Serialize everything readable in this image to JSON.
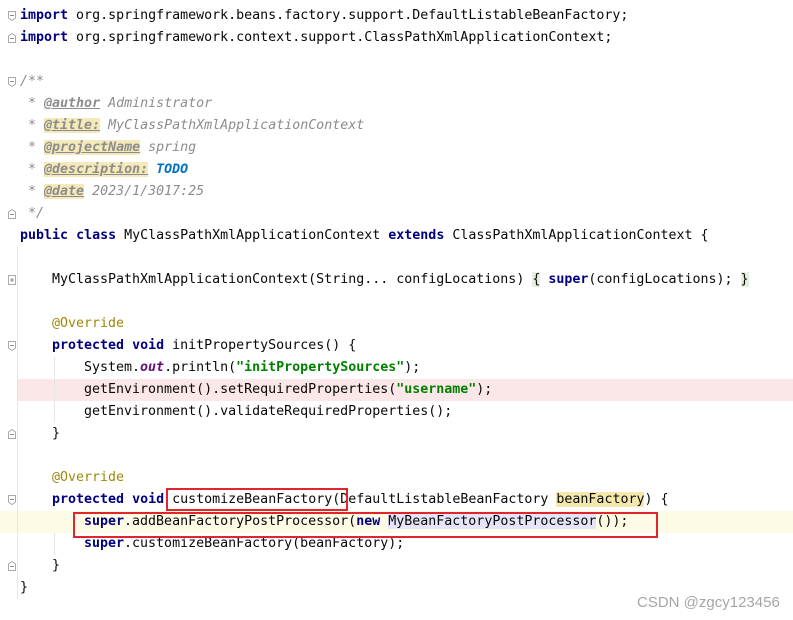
{
  "theme": {
    "keyword": "#000080",
    "string": "#008000",
    "annotation": "#9e880d",
    "comment": "#8c8c8c",
    "doc_tag_warning_bg": "#f3e9b9",
    "todo": "#0073bf",
    "static_field": "#660e7a",
    "error_line_bg": "#fbe7e7",
    "caret_line_bg": "#fdfbe5",
    "usage_bg": "#f5e8ac",
    "identifier_bg": "#e6e4f8",
    "fold_placeholder_bg": "#e4efe0",
    "annotation_box": "#e0262b"
  },
  "icons": {
    "fold_start": "fold-start-icon",
    "fold_end": "fold-end-icon",
    "fold_collapsed": "fold-expand-icon"
  },
  "editor": {
    "lines": {
      "l01": [
        "import",
        " org.springframework.beans.factory.support.DefaultListableBeanFactory;"
      ],
      "l02": [
        "import",
        " org.springframework.context.support.ClassPathXmlApplicationContext;"
      ],
      "l04": [
        "/**"
      ],
      "l05": [
        " * ",
        "@author",
        " Administrator"
      ],
      "l06": [
        " * ",
        "@title:",
        " MyClassPathXmlApplicationContext"
      ],
      "l07": [
        " * ",
        "@projectName",
        " spring"
      ],
      "l08": [
        " * ",
        "@description:",
        " ",
        "TODO"
      ],
      "l09": [
        " * ",
        "@date",
        " 2023/1/3017:25"
      ],
      "l10": [
        " */"
      ],
      "l11": [
        "public",
        " ",
        "class",
        " MyClassPathXmlApplicationContext ",
        "extends",
        " ClassPathXmlApplicationContext {"
      ],
      "l13": [
        "MyClassPathXmlApplicationContext(String... configLocations) ",
        "{",
        " ",
        "super",
        "(configLocations); ",
        "}"
      ],
      "l15": [
        "@Override"
      ],
      "l16": [
        "protected",
        " ",
        "void",
        " initPropertySources() {"
      ],
      "l17": [
        "System.",
        "out",
        ".println(",
        "\"initPropertySources\"",
        ");"
      ],
      "l18": [
        "getEnvironment().setRequiredProperties(",
        "\"username\"",
        ");"
      ],
      "l19": [
        "getEnvironment().validateRequiredProperties();"
      ],
      "l20": [
        "}"
      ],
      "l22": [
        "@Override"
      ],
      "l23": [
        "protected",
        " ",
        "void",
        " ",
        "customizeBeanFactory(",
        "DefaultListableBeanFactory ",
        "beanFactory",
        ") {"
      ],
      "l24": [
        "super",
        ".addBeanFactoryPostProcessor(",
        "new",
        " ",
        "MyBeanFactoryPostProcessor",
        "());"
      ],
      "l25": [
        "super",
        ".customizeBeanFactory(beanFactory);"
      ],
      "l26": [
        "}"
      ],
      "l27": [
        "}"
      ]
    }
  },
  "watermark": "CSDN @zgcy123456"
}
